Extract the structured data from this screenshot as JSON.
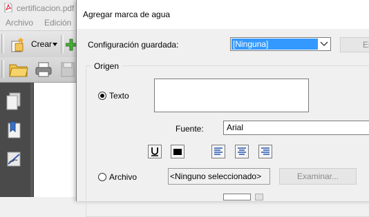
{
  "app": {
    "title": "certificacion.pdf",
    "menu": [
      "Archivo",
      "Edición"
    ],
    "create_label": "Crear"
  },
  "dialog": {
    "title": "Agregar marca de agua",
    "saved_config_label": "Configuración guardada:",
    "saved_config_value": "[Ninguna]",
    "partial_button_label": "El",
    "origin_group_label": "Origen",
    "text_radio_label": "Texto",
    "text_value": "",
    "font_label": "Fuente:",
    "font_value": "Arial",
    "file_radio_label": "Archivo",
    "file_value": "<Ninguno seleccionado>",
    "browse_label": "Examinar...",
    "color_swatch": "#000000",
    "selection_color": "#3399ff"
  }
}
